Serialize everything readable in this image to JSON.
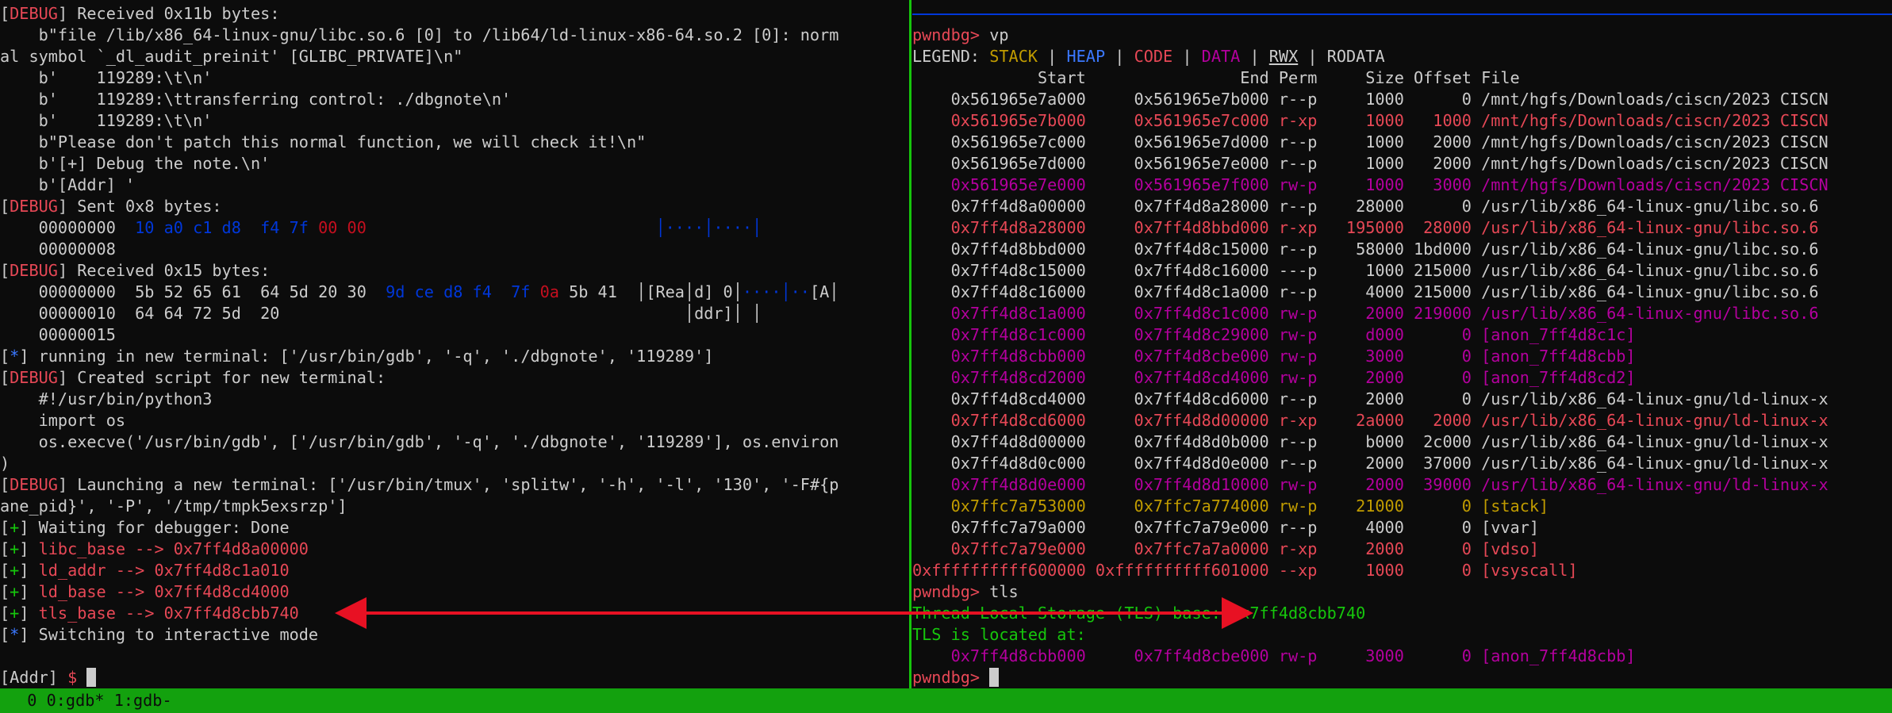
{
  "left_pane": {
    "lines": [
      [
        [
          "[",
          "gray"
        ],
        [
          "DEBUG",
          "red"
        ],
        [
          "] Received 0x11b bytes:",
          "gray"
        ]
      ],
      [
        [
          "    b\"file /lib/x86_64-linux-gnu/libc.so.6 [0] to /lib64/ld-linux-x86-64.so.2 [0]: norm",
          "gray"
        ]
      ],
      [
        [
          "al symbol `_dl_audit_preinit' [GLIBC_PRIVATE]\\n\"",
          "gray"
        ]
      ],
      [
        [
          "    b'    119289:\\t\\n'",
          "gray"
        ]
      ],
      [
        [
          "    b'    119289:\\ttransferring control: ./dbgnote\\n'",
          "gray"
        ]
      ],
      [
        [
          "    b'    119289:\\t\\n'",
          "gray"
        ]
      ],
      [
        [
          "    b\"Please don't patch this normal function, we will check it!\\n\"",
          "gray"
        ]
      ],
      [
        [
          "    b'[+] Debug the note.\\n'",
          "gray"
        ]
      ],
      [
        [
          "    b'[Addr] '",
          "gray"
        ]
      ],
      [
        [
          "[",
          "gray"
        ],
        [
          "DEBUG",
          "red"
        ],
        [
          "] Sent 0x8 bytes:",
          "gray"
        ]
      ],
      [
        [
          "    00000000  ",
          "gray"
        ],
        [
          "10 a0 c1 d8  f4 7f ",
          "dblue"
        ],
        [
          "00 00",
          "dred"
        ],
        [
          "                              ",
          "gray"
        ],
        [
          "│····│····│",
          "dblue"
        ]
      ],
      [
        [
          "    00000008",
          "gray"
        ]
      ],
      [
        [
          "[",
          "gray"
        ],
        [
          "DEBUG",
          "red"
        ],
        [
          "] Received 0x15 bytes:",
          "gray"
        ]
      ],
      [
        [
          "    00000000  5b 52 65 61  64 5d 20 30  ",
          "gray"
        ],
        [
          "9d ce d8 f4  7f ",
          "dblue"
        ],
        [
          "0a",
          "dred"
        ],
        [
          " 5b 41  │[Rea│d] 0│",
          "gray"
        ],
        [
          "····│··",
          "dblue"
        ],
        [
          "[A│",
          "gray"
        ]
      ],
      [
        [
          "    00000010  64 64 72 5d  20                                          │ddr]│ │",
          "gray"
        ]
      ],
      [
        [
          "    00000015",
          "gray"
        ]
      ],
      [
        [
          "[",
          "gray"
        ],
        [
          "*",
          "blue"
        ],
        [
          "] running in new terminal: ['/usr/bin/gdb', '-q', './dbgnote', '119289']",
          "gray"
        ]
      ],
      [
        [
          "[",
          "gray"
        ],
        [
          "DEBUG",
          "red"
        ],
        [
          "] Created script for new terminal:",
          "gray"
        ]
      ],
      [
        [
          "    #!/usr/bin/python3",
          "gray"
        ]
      ],
      [
        [
          "    import os",
          "gray"
        ]
      ],
      [
        [
          "    os.execve('/usr/bin/gdb', ['/usr/bin/gdb', '-q', './dbgnote', '119289'], os.environ",
          "gray"
        ]
      ],
      [
        [
          ")",
          "gray"
        ]
      ],
      [
        [
          "[",
          "gray"
        ],
        [
          "DEBUG",
          "red"
        ],
        [
          "] Launching a new terminal: ['/usr/bin/tmux', 'splitw', '-h', '-l', '130', '-F#{p",
          "gray"
        ]
      ],
      [
        [
          "ane_pid}', '-P', '/tmp/tmpk5exsrzp']",
          "gray"
        ]
      ],
      [
        [
          "[",
          "gray"
        ],
        [
          "+",
          "green"
        ],
        [
          "] Waiting for debugger: Done",
          "gray"
        ]
      ],
      [
        [
          "[",
          "gray"
        ],
        [
          "+",
          "green"
        ],
        [
          "] ",
          "gray"
        ],
        [
          "libc_base --> 0x7ff4d8a00000",
          "red"
        ]
      ],
      [
        [
          "[",
          "gray"
        ],
        [
          "+",
          "green"
        ],
        [
          "] ",
          "gray"
        ],
        [
          "ld_addr --> 0x7ff4d8c1a010",
          "red"
        ]
      ],
      [
        [
          "[",
          "gray"
        ],
        [
          "+",
          "green"
        ],
        [
          "] ",
          "gray"
        ],
        [
          "ld_base --> 0x7ff4d8cd4000",
          "red"
        ]
      ],
      [
        [
          "[",
          "gray"
        ],
        [
          "+",
          "green"
        ],
        [
          "] ",
          "gray"
        ],
        [
          "tls_base --> 0x7ff4d8cbb740",
          "red"
        ]
      ],
      [
        [
          "[",
          "gray"
        ],
        [
          "*",
          "blue"
        ],
        [
          "] Switching to interactive mode",
          "gray"
        ]
      ],
      [
        [
          "",
          "gray"
        ]
      ],
      [
        [
          "[Addr] ",
          "gray"
        ],
        [
          "$ ",
          "red"
        ]
      ]
    ]
  },
  "right_pane": {
    "prompt_line": [
      [
        "pwndbg> ",
        "red"
      ],
      [
        "vp",
        "gray"
      ]
    ],
    "legend_line": [
      [
        "LEGEND: ",
        "gray"
      ],
      [
        "STACK",
        "gold"
      ],
      [
        " | ",
        "gray"
      ],
      [
        "HEAP",
        "blue"
      ],
      [
        " | ",
        "gray"
      ],
      [
        "CODE",
        "red"
      ],
      [
        " | ",
        "gray"
      ],
      [
        "DATA",
        "purple"
      ],
      [
        " | ",
        "gray"
      ],
      [
        "RWX",
        "gray-u"
      ],
      [
        " | RODATA",
        "gray"
      ]
    ],
    "table_header": "             Start                End Perm     Size Offset File",
    "rows": [
      {
        "start": "0x561965e7a000",
        "end": "0x561965e7b000",
        "perm": "r--p",
        "size": "1000",
        "offset": "0",
        "file": "/mnt/hgfs/Downloads/ciscn/2023 CISCN",
        "color": "gray"
      },
      {
        "start": "0x561965e7b000",
        "end": "0x561965e7c000",
        "perm": "r-xp",
        "size": "1000",
        "offset": "1000",
        "file": "/mnt/hgfs/Downloads/ciscn/2023 CISCN",
        "color": "red"
      },
      {
        "start": "0x561965e7c000",
        "end": "0x561965e7d000",
        "perm": "r--p",
        "size": "1000",
        "offset": "2000",
        "file": "/mnt/hgfs/Downloads/ciscn/2023 CISCN",
        "color": "gray"
      },
      {
        "start": "0x561965e7d000",
        "end": "0x561965e7e000",
        "perm": "r--p",
        "size": "1000",
        "offset": "2000",
        "file": "/mnt/hgfs/Downloads/ciscn/2023 CISCN",
        "color": "gray"
      },
      {
        "start": "0x561965e7e000",
        "end": "0x561965e7f000",
        "perm": "rw-p",
        "size": "1000",
        "offset": "3000",
        "file": "/mnt/hgfs/Downloads/ciscn/2023 CISCN",
        "color": "purple"
      },
      {
        "start": "0x7ff4d8a00000",
        "end": "0x7ff4d8a28000",
        "perm": "r--p",
        "size": "28000",
        "offset": "0",
        "file": "/usr/lib/x86_64-linux-gnu/libc.so.6",
        "color": "gray"
      },
      {
        "start": "0x7ff4d8a28000",
        "end": "0x7ff4d8bbd000",
        "perm": "r-xp",
        "size": "195000",
        "offset": "28000",
        "file": "/usr/lib/x86_64-linux-gnu/libc.so.6",
        "color": "red"
      },
      {
        "start": "0x7ff4d8bbd000",
        "end": "0x7ff4d8c15000",
        "perm": "r--p",
        "size": "58000",
        "offset": "1bd000",
        "file": "/usr/lib/x86_64-linux-gnu/libc.so.6",
        "color": "gray"
      },
      {
        "start": "0x7ff4d8c15000",
        "end": "0x7ff4d8c16000",
        "perm": "---p",
        "size": "1000",
        "offset": "215000",
        "file": "/usr/lib/x86_64-linux-gnu/libc.so.6",
        "color": "gray"
      },
      {
        "start": "0x7ff4d8c16000",
        "end": "0x7ff4d8c1a000",
        "perm": "r--p",
        "size": "4000",
        "offset": "215000",
        "file": "/usr/lib/x86_64-linux-gnu/libc.so.6",
        "color": "gray"
      },
      {
        "start": "0x7ff4d8c1a000",
        "end": "0x7ff4d8c1c000",
        "perm": "rw-p",
        "size": "2000",
        "offset": "219000",
        "file": "/usr/lib/x86_64-linux-gnu/libc.so.6",
        "color": "purple"
      },
      {
        "start": "0x7ff4d8c1c000",
        "end": "0x7ff4d8c29000",
        "perm": "rw-p",
        "size": "d000",
        "offset": "0",
        "file": "[anon_7ff4d8c1c]",
        "color": "purple"
      },
      {
        "start": "0x7ff4d8cbb000",
        "end": "0x7ff4d8cbe000",
        "perm": "rw-p",
        "size": "3000",
        "offset": "0",
        "file": "[anon_7ff4d8cbb]",
        "color": "purple"
      },
      {
        "start": "0x7ff4d8cd2000",
        "end": "0x7ff4d8cd4000",
        "perm": "rw-p",
        "size": "2000",
        "offset": "0",
        "file": "[anon_7ff4d8cd2]",
        "color": "purple"
      },
      {
        "start": "0x7ff4d8cd4000",
        "end": "0x7ff4d8cd6000",
        "perm": "r--p",
        "size": "2000",
        "offset": "0",
        "file": "/usr/lib/x86_64-linux-gnu/ld-linux-x",
        "color": "gray"
      },
      {
        "start": "0x7ff4d8cd6000",
        "end": "0x7ff4d8d00000",
        "perm": "r-xp",
        "size": "2a000",
        "offset": "2000",
        "file": "/usr/lib/x86_64-linux-gnu/ld-linux-x",
        "color": "red"
      },
      {
        "start": "0x7ff4d8d00000",
        "end": "0x7ff4d8d0b000",
        "perm": "r--p",
        "size": "b000",
        "offset": "2c000",
        "file": "/usr/lib/x86_64-linux-gnu/ld-linux-x",
        "color": "gray"
      },
      {
        "start": "0x7ff4d8d0c000",
        "end": "0x7ff4d8d0e000",
        "perm": "r--p",
        "size": "2000",
        "offset": "37000",
        "file": "/usr/lib/x86_64-linux-gnu/ld-linux-x",
        "color": "gray"
      },
      {
        "start": "0x7ff4d8d0e000",
        "end": "0x7ff4d8d10000",
        "perm": "rw-p",
        "size": "2000",
        "offset": "39000",
        "file": "/usr/lib/x86_64-linux-gnu/ld-linux-x",
        "color": "purple"
      },
      {
        "start": "0x7ffc7a753000",
        "end": "0x7ffc7a774000",
        "perm": "rw-p",
        "size": "21000",
        "offset": "0",
        "file": "[stack]",
        "color": "gold"
      },
      {
        "start": "0x7ffc7a79a000",
        "end": "0x7ffc7a79e000",
        "perm": "r--p",
        "size": "4000",
        "offset": "0",
        "file": "[vvar]",
        "color": "gray"
      },
      {
        "start": "0x7ffc7a79e000",
        "end": "0x7ffc7a7a0000",
        "perm": "r-xp",
        "size": "2000",
        "offset": "0",
        "file": "[vdso]",
        "color": "red"
      },
      {
        "start": "0xffffffffff600000",
        "end": "0xffffffffff601000",
        "perm": "--xp",
        "size": "1000",
        "offset": "0",
        "file": "[vsyscall]",
        "color": "red"
      }
    ],
    "tls_prompt": [
      [
        "pwndbg> ",
        "red"
      ],
      [
        "tls",
        "gray"
      ]
    ],
    "tls_base_line": [
      [
        "Thread Local Storage (TLS) base: ",
        "green"
      ],
      [
        "0x7ff4d8cbb740",
        "green"
      ]
    ],
    "tls_located": [
      [
        "TLS is located at:",
        "green"
      ]
    ],
    "tls_row": {
      "start": "0x7ff4d8cbb000",
      "end": "0x7ff4d8cbe000",
      "perm": "rw-p",
      "size": "3000",
      "offset": "0",
      "file": "[anon_7ff4d8cbb]",
      "color": "purple"
    },
    "final_prompt": [
      [
        "pwndbg> ",
        "red"
      ]
    ]
  },
  "status_bar": {
    "text": "  0 0:gdb* 1:gdb-"
  },
  "colors": {
    "red": "#e74856",
    "green": "#16c60c",
    "arrow": "#e81123",
    "status_bg": "#13a10e"
  }
}
